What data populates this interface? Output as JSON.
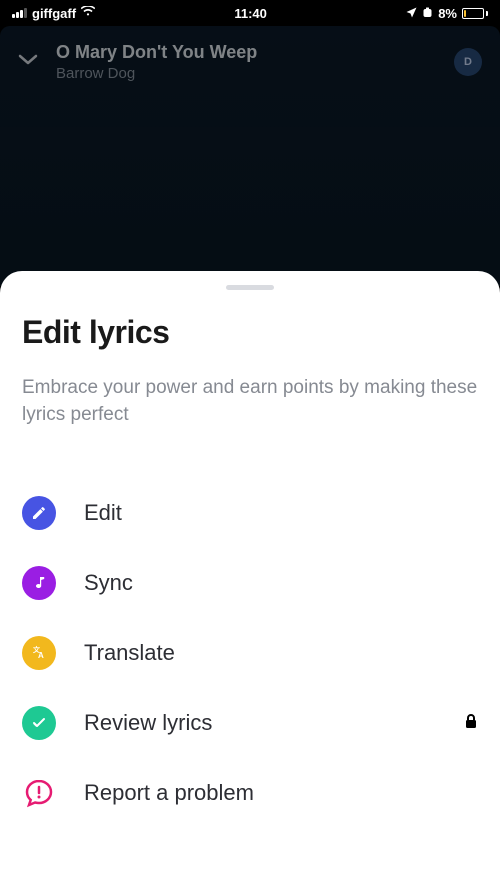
{
  "status": {
    "carrier": "giffgaff",
    "time": "11:40",
    "battery_pct": "8%"
  },
  "player": {
    "song_title": "O Mary Don't You Weep",
    "artist": "Barrow Dog",
    "avatar_letter": "D"
  },
  "sheet": {
    "title": "Edit lyrics",
    "subtitle": "Embrace your power and earn points by making these lyrics perfect",
    "options": {
      "edit": "Edit",
      "sync": "Sync",
      "translate": "Translate",
      "review": "Review lyrics",
      "report": "Report a problem"
    }
  }
}
